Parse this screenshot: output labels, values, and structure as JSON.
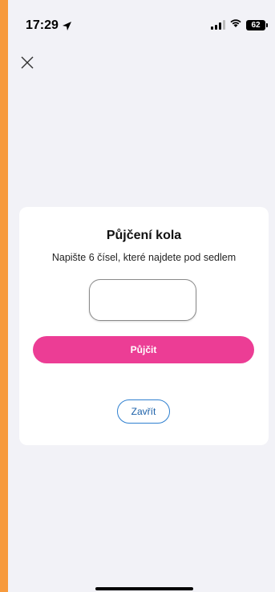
{
  "status_bar": {
    "time": "17:29",
    "battery": "62",
    "icons": [
      "location-arrow-icon",
      "signal-icon",
      "wifi-icon",
      "battery-icon"
    ]
  },
  "nav": {
    "close_icon": "close-icon"
  },
  "dialog": {
    "title": "Půjčení kola",
    "subtitle": "Napište 6 čísel, které najdete pod sedlem",
    "code_input": {
      "value": "",
      "placeholder": ""
    },
    "primary_button": "Půjčit",
    "secondary_button": "Zavřít"
  },
  "colors": {
    "frame": "#f79a3c",
    "background": "#f2f2f7",
    "card": "#ffffff",
    "primary": "#ec3d95",
    "secondary_border": "#2f80d0"
  }
}
